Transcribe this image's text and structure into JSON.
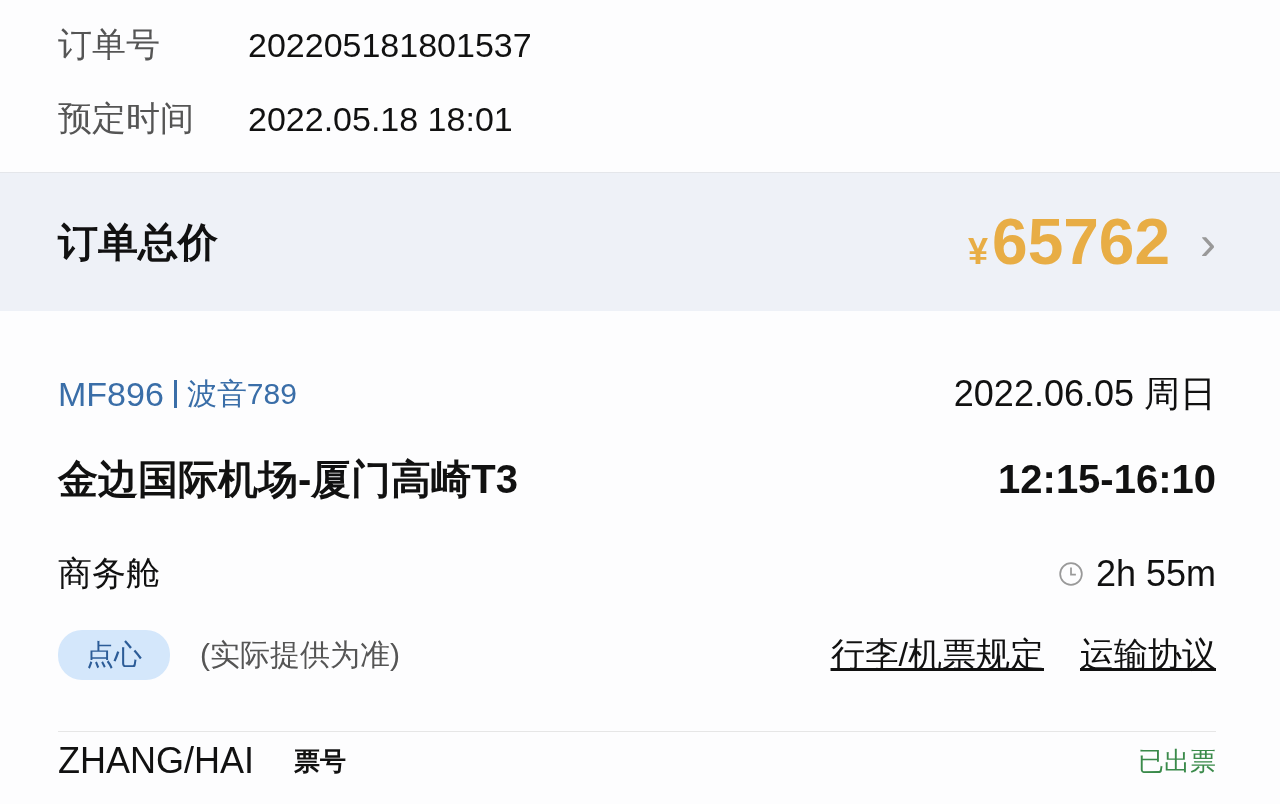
{
  "order_info": [
    {
      "label": "订单号",
      "value": "202205181801537"
    },
    {
      "label": "预定时间",
      "value": "2022.05.18 18:01"
    }
  ],
  "total": {
    "label": "订单总价",
    "currency": "¥",
    "amount": "65762",
    "chevron": "›"
  },
  "flight": {
    "number": "MF896",
    "aircraft": "波音789",
    "date": "2022.06.05 周日",
    "route": "金边国际机场-厦门高崎T3",
    "time": "12:15-16:10",
    "cabin": "商务舱",
    "duration": "2h 55m",
    "meal_tag": "点心",
    "meal_note": "(实际提供为准)",
    "links": [
      "行李/机票规定",
      "运输协议"
    ]
  },
  "passenger": {
    "name": "ZHANG/HAI",
    "ticket_label": "票号",
    "status": "已出票"
  }
}
